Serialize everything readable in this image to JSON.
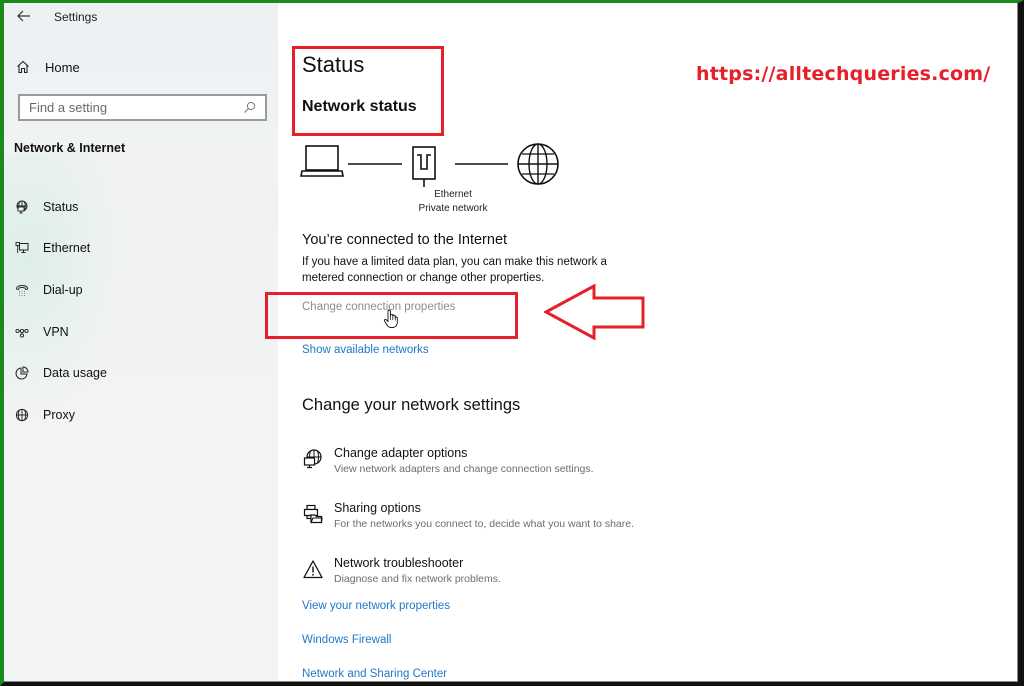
{
  "window": {
    "title": "Settings",
    "back_icon": "arrow-left-icon"
  },
  "sidebar": {
    "home_label": "Home",
    "home_icon": "home-icon",
    "search": {
      "placeholder": "Find a setting",
      "value": "",
      "icon": "search-icon"
    },
    "section_title": "Network & Internet",
    "items": [
      {
        "label": "Status",
        "icon": "globe-monitor-icon"
      },
      {
        "label": "Ethernet",
        "icon": "ethernet-icon"
      },
      {
        "label": "Dial-up",
        "icon": "dial-up-icon"
      },
      {
        "label": "VPN",
        "icon": "vpn-icon"
      },
      {
        "label": "Data usage",
        "icon": "data-usage-icon"
      },
      {
        "label": "Proxy",
        "icon": "globe-icon"
      }
    ]
  },
  "main": {
    "page_title": "Status",
    "subtitle": "Network status",
    "diagram": {
      "adapter_name": "Ethernet",
      "network_type": "Private network"
    },
    "connected_title": "You’re connected to the Internet",
    "connected_desc": "If you have a limited data plan, you can make this network a metered connection or change other properties.",
    "change_connection_link": "Change connection properties",
    "show_networks_link": "Show available networks",
    "change_settings_title": "Change your network settings",
    "settings": [
      {
        "name": "Change adapter options",
        "desc": "View network adapters and change connection settings.",
        "icon": "adapter-icon"
      },
      {
        "name": "Sharing options",
        "desc": "For the networks you connect to, decide what you want to share.",
        "icon": "sharing-icon"
      },
      {
        "name": "Network troubleshooter",
        "desc": "Diagnose and fix network problems.",
        "icon": "warning-icon"
      }
    ],
    "links": {
      "view_properties": "View your network properties",
      "firewall": "Windows Firewall",
      "sharing_center": "Network and Sharing Center"
    }
  },
  "annotations": {
    "watermark": "https://alltechqueries.com/",
    "accent_color": "#e5202a",
    "link_color": "#1f78c8"
  }
}
